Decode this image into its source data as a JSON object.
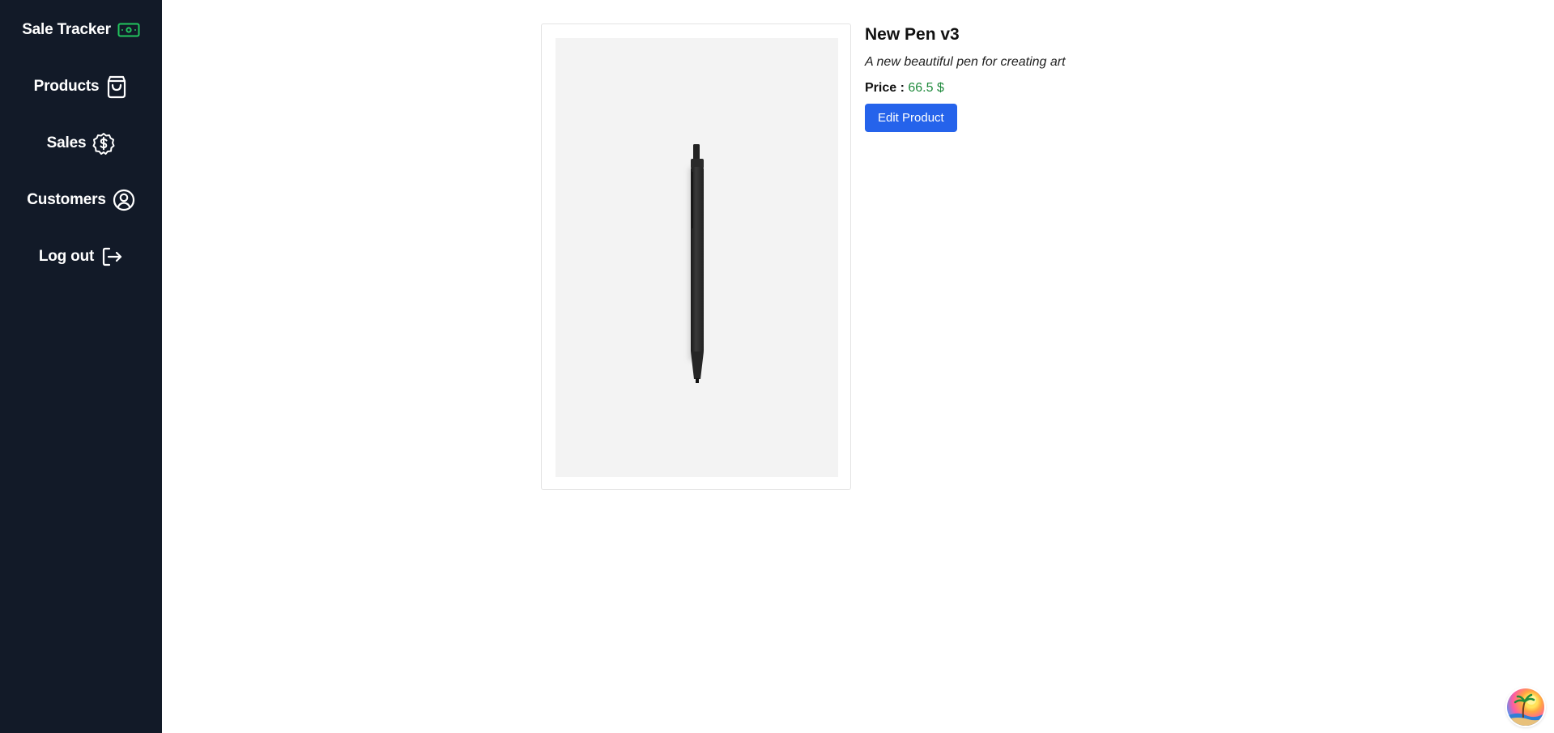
{
  "sidebar": {
    "brand": "Sale Tracker",
    "items": [
      {
        "label": "Products",
        "icon": "shopping-bag-icon"
      },
      {
        "label": "Sales",
        "icon": "dollar-badge-icon"
      },
      {
        "label": "Customers",
        "icon": "user-circle-icon"
      },
      {
        "label": "Log out",
        "icon": "logout-icon"
      }
    ],
    "brand_icon": "cash-icon",
    "brand_icon_color": "#22c55e"
  },
  "product": {
    "name": "New Pen v3",
    "description": "A new beautiful pen for creating art",
    "price_label": "Price :",
    "price_value": "66.5 $",
    "edit_label": "Edit Product",
    "image": "pen-image"
  },
  "colors": {
    "sidebar_bg": "#121a28",
    "accent": "#2563eb",
    "price": "#1f8a3c"
  }
}
